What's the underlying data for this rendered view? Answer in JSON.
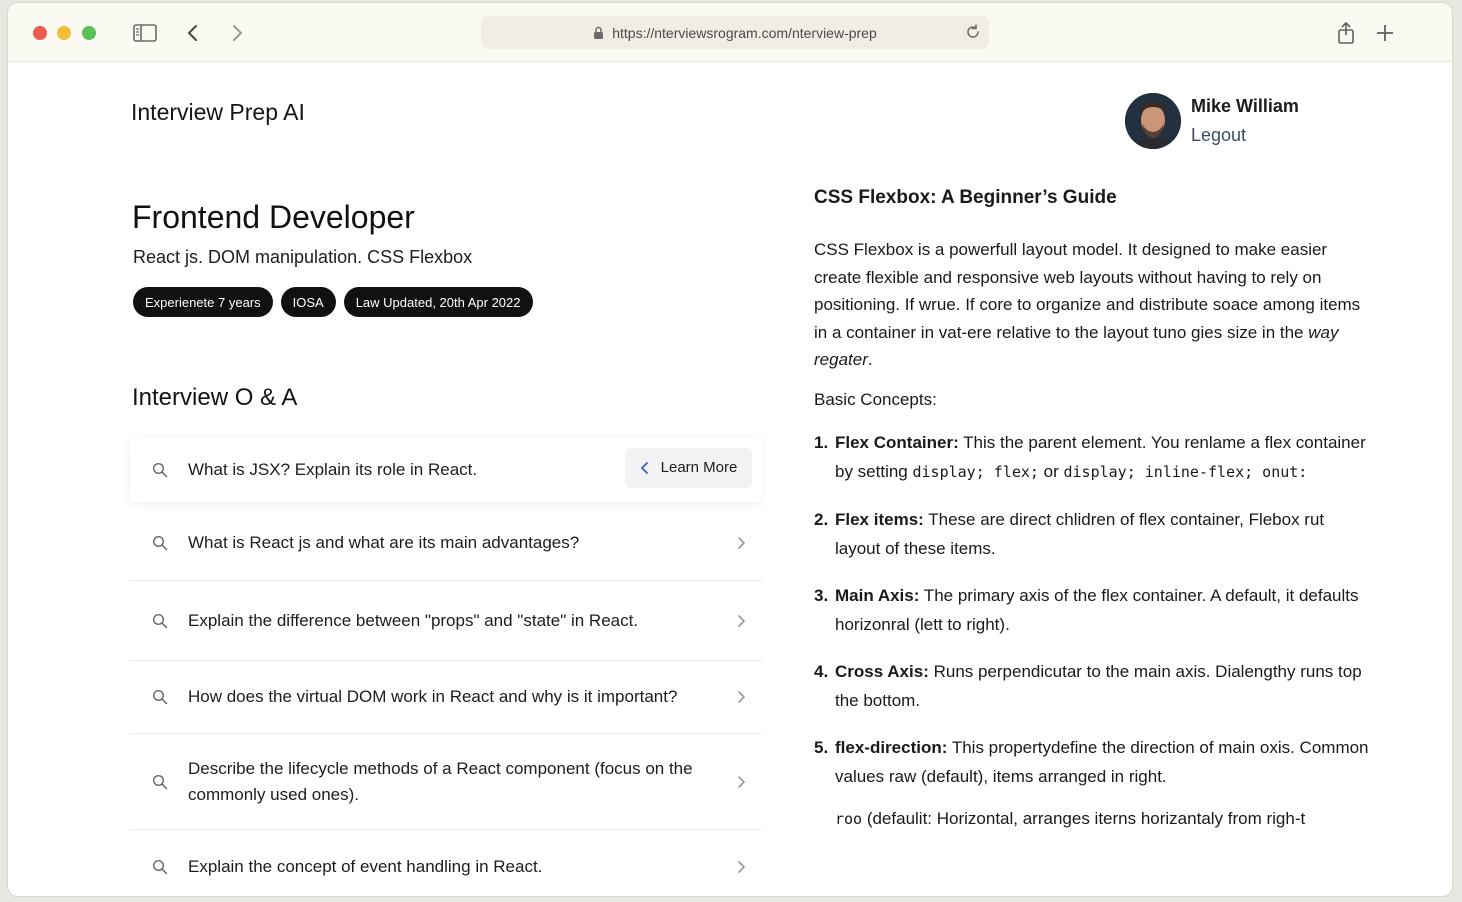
{
  "browser": {
    "url": "https://nterviewsrogram.com/nterview-prep"
  },
  "app": {
    "title": "Interview Prep AI"
  },
  "user": {
    "name": "Mike William",
    "logout_label": "Legout"
  },
  "job": {
    "title": "Frontend Developer",
    "skills": "React js. DOM manipulation. CSS Flexbox",
    "badges": [
      "Experienete  7 years",
      "IOSA",
      "Law Updated, 20th Apr 2022"
    ]
  },
  "qa": {
    "title": "Interview O & A",
    "learn_more_label": "Learn More",
    "items": [
      "What is JSX? Explain its role in React.",
      "What is React js and what are its main advantages?",
      "Explain the difference between \"props\" and \"state\" in React.",
      "How does the virtual DOM work in React and why is it important?",
      "Describe the lifecycle methods of a React component (focus on the commonly used ones).",
      "Explain the concept of event handling in React."
    ]
  },
  "article": {
    "title": "CSS Flexbox: A Beginner’s Guide",
    "intro_main": "CSS Flexbox is a powerfull layout model.  It designed to make easier create flexible and responsive web layouts without having to rely on positioning. If wrue. If core to organize and distribute soace among items in a container in vat-ere relative to the layout tuno gies size in the",
    "intro_em": "way regater",
    "intro_end": ".",
    "basic_label": "Basic Concepts:",
    "concepts": [
      {
        "num": "1.",
        "term": "Flex Container:",
        "text": " This the parent element. You renlame a flex container by setting ",
        "code1": "display; flex;",
        "mid": " or ",
        "code2": "display; inline-flex; onut:"
      },
      {
        "num": "2.",
        "term": "Flex items:",
        "text": " These are direct chlidren of flex container, Flebox rut layout of these items."
      },
      {
        "num": "3.",
        "term": "Main Axis:",
        "text": " The primary  axis of the flex container. A default, it defaults horizonral (lett to right)."
      },
      {
        "num": "4.",
        "term": "Cross Axis:",
        "text": " Runs perpendicutar  to  the main axis. Dialengthy runs top  the bottom."
      },
      {
        "num": "5.",
        "term": "flex-direction:",
        "text": " This propertydefine the direction of main oxis. Common values raw (default), items arranged in right."
      }
    ],
    "tail_code": "roo",
    "tail_text": " (defaulit: Horizontal, arranges iterns horizantaly from righ-t"
  }
}
